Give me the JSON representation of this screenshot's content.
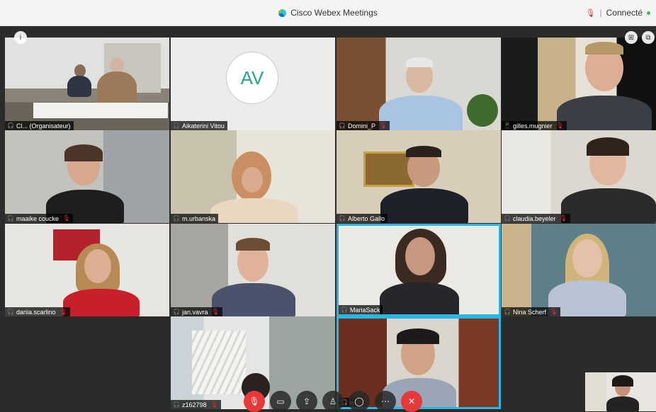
{
  "window": {
    "title": "Cisco Webex Meetings",
    "status": "Connecté"
  },
  "participants": [
    {
      "name": "Cl...  (Organisateur)",
      "muted": false,
      "icon": "headset"
    },
    {
      "name": "Aikaterini Vitou",
      "muted": false,
      "icon": "headset",
      "initials": "AV"
    },
    {
      "name": "Domini_P",
      "muted": true,
      "icon": "headset"
    },
    {
      "name": "gilles.mugnier",
      "muted": true,
      "icon": "phone"
    },
    {
      "name": "maaike coucke",
      "muted": true,
      "icon": "headset"
    },
    {
      "name": "m.urbanska",
      "muted": false,
      "icon": "headset"
    },
    {
      "name": "Alberto Gallo",
      "muted": false,
      "icon": "headset"
    },
    {
      "name": "claudia.beyeler",
      "muted": true,
      "icon": "headset"
    },
    {
      "name": "dariia.scarlino",
      "muted": true,
      "icon": "headset"
    },
    {
      "name": "jan.vavra",
      "muted": true,
      "icon": "headset"
    },
    {
      "name": "MariaSack",
      "muted": false,
      "icon": "headset"
    },
    {
      "name": "Nina Scherf",
      "muted": true,
      "icon": "headset"
    },
    {
      "name": "z162798",
      "muted": true,
      "icon": "headset"
    },
    {
      "name": "n",
      "muted": false,
      "icon": "headset"
    }
  ],
  "controls": {
    "info_icon": "info-icon",
    "layout_icon": "grid-layout-icon",
    "popout_icon": "popout-icon",
    "toolbar": [
      "mute-icon",
      "video-icon",
      "share-icon",
      "participants-icon",
      "chat-icon",
      "more-icon",
      "leave-icon"
    ]
  },
  "colors": {
    "accent": "#2ab6e4",
    "danger": "#e63a3a",
    "connected": "#2fbf4d"
  }
}
